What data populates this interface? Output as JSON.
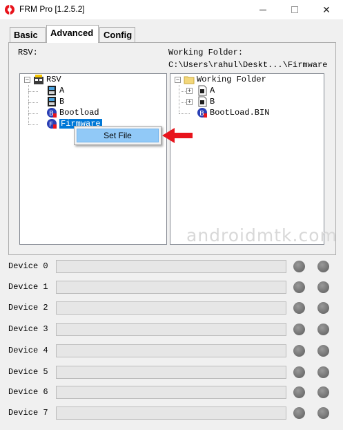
{
  "window": {
    "title": "FRM Pro [1.2.5.2]",
    "minimize": "—",
    "maximize": "☐",
    "close": "✕"
  },
  "tabs": [
    {
      "label": "Basic",
      "active": false
    },
    {
      "label": "Advanced",
      "active": true
    },
    {
      "label": "Config",
      "active": false
    }
  ],
  "left_pane": {
    "label": "RSV:",
    "root": "RSV",
    "items": [
      "A",
      "B",
      "Bootload",
      "Firmware"
    ],
    "selected": "Firmware"
  },
  "right_pane": {
    "label": "Working Folder:",
    "path": "C:\\Users\\rahul\\Deskt...\\Firmware",
    "root": "Working Folder",
    "items": [
      "A",
      "B",
      "BootLoad.BIN"
    ]
  },
  "context_menu": {
    "items": [
      "Set File"
    ]
  },
  "watermark": "androidmtk.com",
  "devices": [
    {
      "label": "Device 0"
    },
    {
      "label": "Device 1"
    },
    {
      "label": "Device 2"
    },
    {
      "label": "Device 3"
    },
    {
      "label": "Device 4"
    },
    {
      "label": "Device 5"
    },
    {
      "label": "Device 6"
    },
    {
      "label": "Device 7"
    }
  ],
  "colors": {
    "accent": "#0078d7",
    "arrow": "#e8141c",
    "menu_highlight": "#91c9f7"
  }
}
